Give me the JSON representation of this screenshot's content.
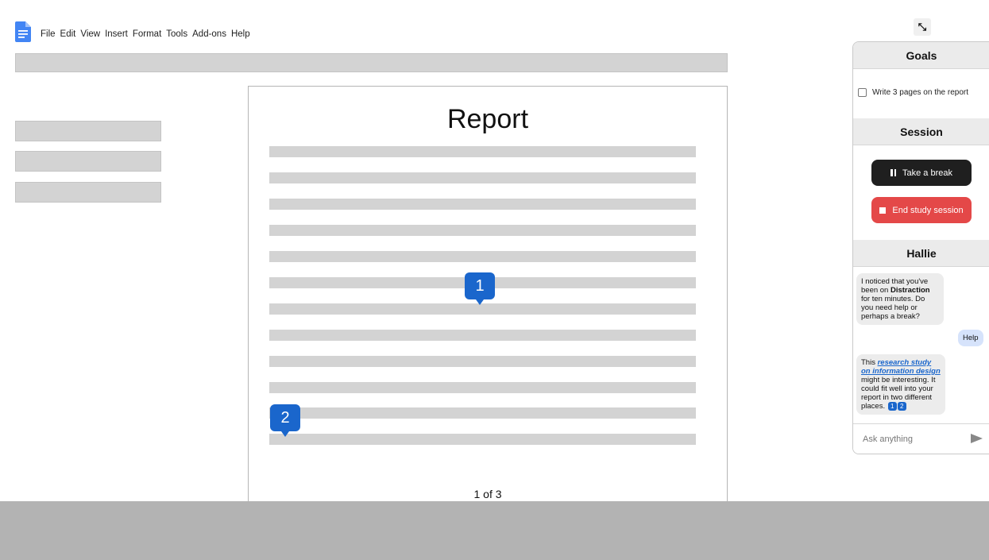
{
  "menu": {
    "items": [
      "File",
      "Edit",
      "View",
      "Insert",
      "Format",
      "Tools",
      "Add-ons",
      "Help"
    ]
  },
  "document": {
    "title": "Report",
    "page_indicator": "1 of 3",
    "markers": [
      "1",
      "2"
    ]
  },
  "panel": {
    "goals_title": "Goals",
    "goal_text": "Write 3 pages on the report",
    "session_title": "Session",
    "break_label": "Take a break",
    "end_label": "End study session",
    "chat_title": "Hallie",
    "messages": {
      "bot1_a": "I noticed that you've been on ",
      "bot1_b": "Distraction",
      "bot1_c": " for ten minutes. Do you need help or perhaps a break?",
      "user1": "Help",
      "bot2_a": "This ",
      "bot2_link": "research study on information design",
      "bot2_b": " might be interesting. It could fit well into your report in two different places. ",
      "marker1": "1",
      "marker2": "2"
    },
    "ask_placeholder": "Ask anything"
  },
  "colors": {
    "accent": "#1a66cc",
    "danger": "#e44848",
    "dark_button": "#1f1f1f"
  }
}
